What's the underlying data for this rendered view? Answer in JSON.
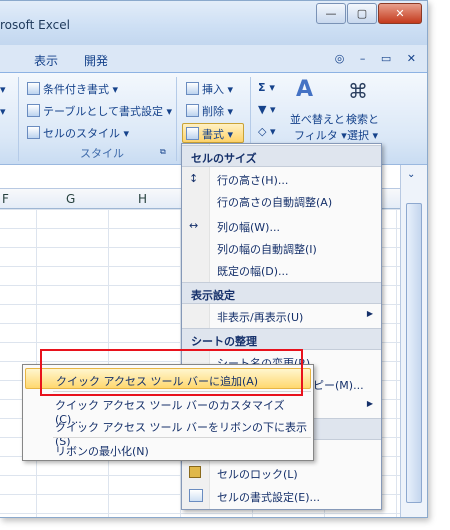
{
  "window": {
    "title": "rosoft Excel",
    "buttons": {
      "minimize": "—",
      "maximize": "▢",
      "close": "✕"
    }
  },
  "tabs": [
    "表示",
    "開発"
  ],
  "help_icons": "◎ – ▭ ✕",
  "ribbon": {
    "styles_group": {
      "conditional": "条件付き書式 ▾",
      "table": "テーブルとして書式設定 ▾",
      "cellstyle": "セルのスタイル ▾",
      "label": "スタイル"
    },
    "cells_group": {
      "insert": "挿入 ▾",
      "delete": "削除 ▾",
      "format": "書式 ▾"
    },
    "edit_group": {
      "sigma": "Σ ▾",
      "sort_line1": "並べ替えと",
      "sort_line2": "フィルタ ▾",
      "find_line1": "検索と",
      "find_line2": "選択 ▾"
    }
  },
  "columns": [
    "F",
    "G",
    "H"
  ],
  "format_menu": {
    "cell_size_header": "セルのサイズ",
    "items_size": [
      "行の高さ(H)...",
      "行の高さの自動調整(A)",
      "列の幅(W)...",
      "列の幅の自動調整(I)",
      "既定の幅(D)..."
    ],
    "display_header": "表示設定",
    "hide_show": "非表示/再表示(U)",
    "organize_header": "シートの整理",
    "rename": "シート名の変更(R)",
    "copy_partial": "ピー(M)...",
    "lock": "セルのロック(L)",
    "format_cells": "セルの書式設定(E)..."
  },
  "context_menu": {
    "items": [
      "クイック アクセス ツール バーに追加(A)",
      "クイック アクセス ツール バーのカスタマイズ(C)...",
      "クイック アクセス ツール バーをリボンの下に表示(S)",
      "リボンの最小化(N)"
    ]
  }
}
